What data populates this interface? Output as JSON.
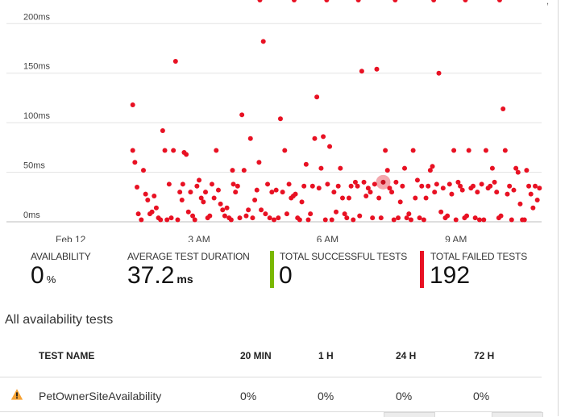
{
  "chart_data": {
    "type": "scatter",
    "ylabel_ticks": [
      "200ms",
      "150ms",
      "100ms",
      "50ms",
      "0ms"
    ],
    "y_ticks": [
      200,
      150,
      100,
      50,
      0
    ],
    "ylim": [
      0,
      210
    ],
    "x_ticks": [
      "Feb 12",
      "3 AM",
      "6 AM",
      "9 AM"
    ],
    "x_tick_hours": [
      0,
      3,
      6,
      9
    ],
    "xlim_hours": [
      -1.5,
      11.0
    ],
    "grid": true,
    "point_color": "#e81123",
    "highlight_color": "#f4a7ad",
    "highlight_point": {
      "x": 7.3,
      "y": 40
    },
    "x": [
      1.45,
      1.45,
      1.5,
      1.55,
      1.65,
      1.7,
      1.75,
      1.8,
      1.85,
      1.9,
      1.95,
      2.0,
      2.05,
      2.1,
      2.15,
      2.2,
      2.25,
      2.3,
      2.35,
      2.4,
      2.45,
      2.5,
      2.55,
      2.6,
      2.65,
      2.7,
      2.75,
      2.8,
      2.85,
      2.9,
      2.95,
      3.0,
      3.05,
      3.1,
      3.15,
      3.2,
      3.25,
      3.3,
      3.35,
      3.4,
      3.45,
      3.5,
      3.55,
      3.6,
      3.65,
      3.7,
      3.75,
      3.8,
      3.85,
      3.9,
      3.95,
      4.0,
      4.05,
      4.1,
      4.15,
      4.2,
      4.25,
      4.3,
      4.35,
      4.4,
      4.45,
      4.5,
      4.55,
      4.6,
      4.65,
      4.7,
      4.75,
      4.8,
      4.85,
      4.9,
      4.95,
      5.0,
      5.05,
      5.1,
      5.15,
      5.2,
      5.25,
      5.3,
      5.35,
      5.4,
      5.45,
      5.5,
      5.55,
      5.6,
      5.65,
      5.7,
      5.75,
      5.8,
      5.85,
      5.9,
      5.95,
      6.0,
      6.05,
      6.1,
      6.15,
      6.2,
      6.25,
      6.3,
      6.35,
      6.4,
      6.45,
      6.5,
      6.55,
      6.6,
      6.65,
      6.7,
      6.75,
      6.8,
      6.85,
      6.9,
      6.95,
      7.0,
      7.05,
      7.1,
      7.15,
      7.2,
      7.25,
      7.35,
      7.4,
      7.45,
      7.5,
      7.55,
      7.6,
      7.65,
      7.7,
      7.75,
      7.8,
      7.85,
      7.9,
      7.95,
      8.0,
      8.05,
      8.1,
      8.15,
      8.2,
      8.25,
      8.3,
      8.35,
      8.4,
      8.45,
      8.5,
      8.55,
      8.6,
      8.65,
      8.7,
      8.75,
      8.8,
      8.85,
      8.9,
      8.95,
      9.0,
      9.05,
      9.1,
      9.15,
      9.2,
      9.25,
      9.3,
      9.35,
      9.4,
      9.45,
      9.5,
      9.55,
      9.6,
      9.65,
      9.7,
      9.75,
      9.8,
      9.85,
      9.9,
      9.95,
      10.0,
      10.05,
      10.1,
      10.15,
      10.2,
      10.25,
      10.3,
      10.35,
      10.4,
      10.45,
      10.5,
      10.55,
      10.6,
      10.65,
      10.7,
      10.75,
      10.8,
      10.85,
      10.9,
      10.95,
      1.58,
      2.62,
      3.78,
      4.42,
      5.22,
      5.98,
      6.72,
      7.58,
      8.48,
      9.22,
      10.02
    ],
    "y": [
      118,
      72,
      60,
      35,
      2,
      52,
      28,
      22,
      8,
      10,
      26,
      14,
      4,
      2,
      92,
      72,
      2,
      38,
      4,
      72,
      162,
      2,
      30,
      22,
      70,
      68,
      10,
      30,
      6,
      2,
      36,
      42,
      24,
      20,
      30,
      4,
      6,
      38,
      24,
      72,
      32,
      18,
      12,
      6,
      14,
      4,
      2,
      38,
      30,
      36,
      4,
      108,
      52,
      6,
      12,
      84,
      4,
      22,
      32,
      60,
      12,
      182,
      8,
      38,
      4,
      30,
      2,
      32,
      4,
      104,
      30,
      72,
      8,
      38,
      24,
      26,
      28,
      4,
      2,
      20,
      36,
      58,
      2,
      8,
      36,
      84,
      126,
      34,
      54,
      86,
      2,
      38,
      76,
      2,
      30,
      10,
      36,
      54,
      24,
      8,
      4,
      24,
      36,
      2,
      40,
      36,
      6,
      152,
      40,
      26,
      34,
      30,
      4,
      38,
      154,
      24,
      4,
      72,
      52,
      34,
      30,
      2,
      40,
      4,
      20,
      36,
      54,
      4,
      8,
      2,
      72,
      24,
      42,
      4,
      36,
      2,
      24,
      36,
      52,
      56,
      30,
      38,
      150,
      10,
      34,
      4,
      6,
      38,
      28,
      72,
      2,
      40,
      36,
      32,
      4,
      6,
      72,
      34,
      36,
      4,
      30,
      2,
      38,
      2,
      72,
      34,
      36,
      54,
      40,
      30,
      4,
      6,
      114,
      72,
      28,
      36,
      2,
      32,
      54,
      50,
      18,
      2,
      2,
      52,
      36,
      28,
      14,
      36,
      22,
      34,
      8,
      38,
      52
    ],
    "metrics": [
      {
        "label": "AVAILABILITY",
        "value": "0",
        "unit": "%"
      },
      {
        "label": "AVERAGE TEST DURATION",
        "value": "37.2",
        "unit": "ms"
      },
      {
        "label": "TOTAL SUCCESSFUL TESTS",
        "value": "0",
        "unit": ""
      },
      {
        "label": "TOTAL FAILED TESTS",
        "value": "192",
        "unit": ""
      }
    ]
  },
  "colors": {
    "success": "#7ab800",
    "failure": "#e81123",
    "warning": "#f7a233"
  },
  "section": {
    "title": "All availability tests"
  },
  "table": {
    "columns": [
      "TEST NAME",
      "20 MIN",
      "1 H",
      "24 H",
      "72 H"
    ],
    "rows": [
      {
        "status_icon": "warning-icon",
        "name": "PetOwnerSiteAvailability",
        "m20": "0%",
        "h1": "0%",
        "h24": "0%",
        "h72": "0%"
      }
    ]
  }
}
